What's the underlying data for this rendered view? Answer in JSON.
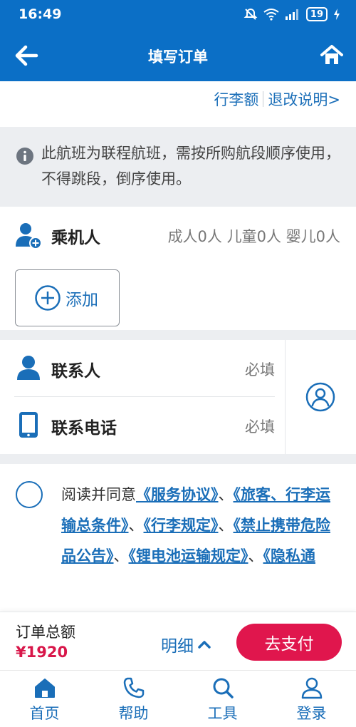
{
  "status_bar": {
    "time": "16:49",
    "battery": "19"
  },
  "header": {
    "title": "填写订单"
  },
  "links": {
    "baggage": "行李额",
    "refund": "退改说明>"
  },
  "notice": {
    "text": "此航班为联程航班，需按所购航段顺序使用，不得跳段，倒序使用。"
  },
  "passenger": {
    "label": "乘机人",
    "counts": "成人0人 儿童0人 婴儿0人",
    "add_label": "添加"
  },
  "contact": {
    "name_label": "联系人",
    "name_required": "必填",
    "phone_label": "联系电话",
    "phone_required": "必填"
  },
  "agreement": {
    "prefix": "阅读并同意",
    "link1": "《服务协议》",
    "sep1": "、",
    "link2": "《旅客、行李运输总条件》",
    "sep2": "、",
    "link3": "《行李规定》",
    "sep3": "、",
    "link4": "《禁止携带危险品公告》",
    "sep4": "、",
    "link5": "《锂电池运输规定》",
    "sep5": "、",
    "link6": "《隐私通"
  },
  "pay_bar": {
    "total_label": "订单总额",
    "amount": "¥1920",
    "detail_label": "明细",
    "pay_label": "去支付"
  },
  "tab_bar": [
    {
      "label": "首页",
      "icon": "home-icon"
    },
    {
      "label": "帮助",
      "icon": "phone-icon"
    },
    {
      "label": "工具",
      "icon": "search-icon"
    },
    {
      "label": "登录",
      "icon": "user-icon"
    }
  ],
  "colors": {
    "primary": "#0b6fc6",
    "link": "#1a6eb8",
    "accent": "#e0164d",
    "background_gray": "#eceef1"
  }
}
